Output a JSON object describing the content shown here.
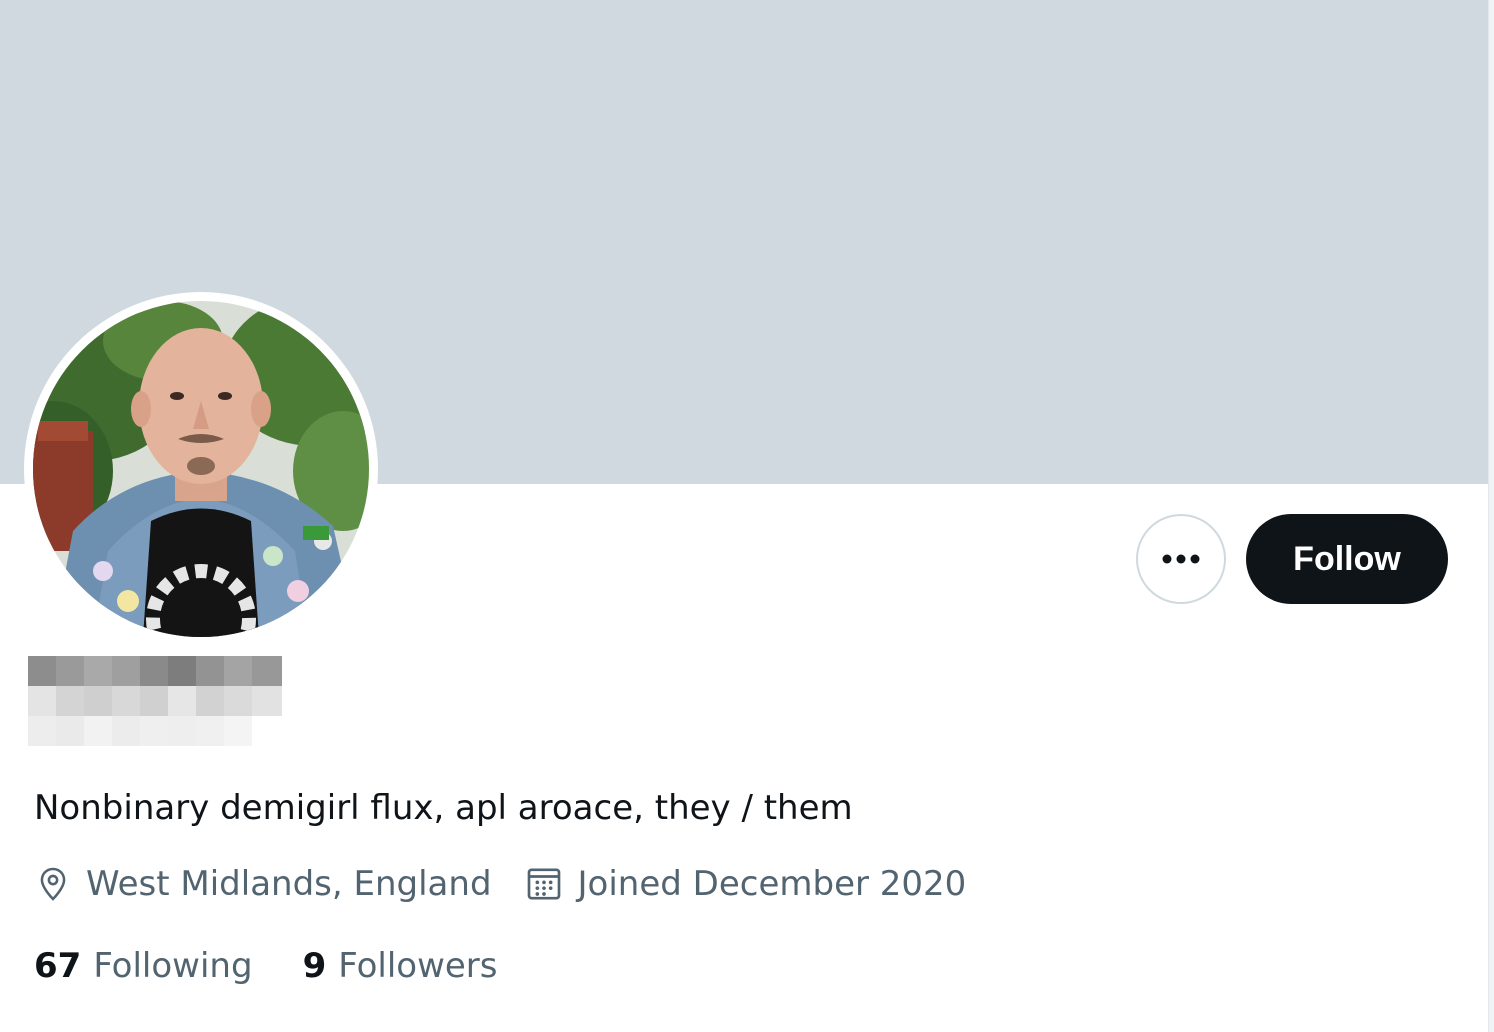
{
  "profile": {
    "bio": "Nonbinary demigirl flux, apl aroace, they / them",
    "location": "West Midlands, England",
    "joined": "Joined December 2020",
    "following_count": "67",
    "following_label": "Following",
    "followers_count": "9",
    "followers_label": "Followers"
  },
  "actions": {
    "follow_label": "Follow",
    "more_icon": "ellipsis-icon"
  },
  "icons": {
    "location": "location-pin-icon",
    "calendar": "calendar-icon"
  },
  "colors": {
    "banner": "#cfd9df",
    "follow_button_bg": "#0f1419",
    "secondary_text": "#536471",
    "primary_text": "#0f1419"
  }
}
